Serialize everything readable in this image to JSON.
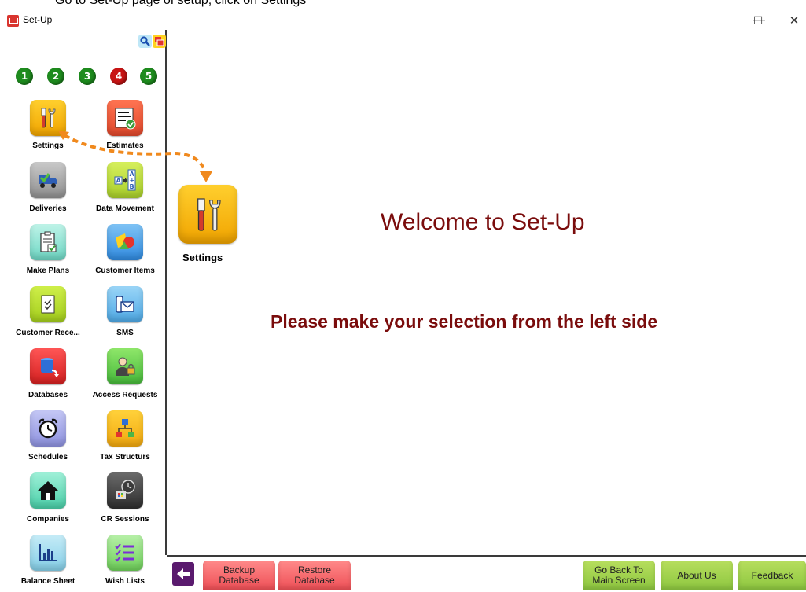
{
  "caption": "Go to Set-Up page of setup, click on Settings",
  "window": {
    "title": "Set-Up",
    "minimize": "—",
    "maximize": "☐",
    "close": "✕"
  },
  "steps": [
    "1",
    "2",
    "3",
    "4",
    "5"
  ],
  "tiles": [
    {
      "label": "Settings"
    },
    {
      "label": "Estimates"
    },
    {
      "label": "Deliveries"
    },
    {
      "label": "Data Movement"
    },
    {
      "label": "Make Plans"
    },
    {
      "label": "Customer Items"
    },
    {
      "label": "Customer Rece..."
    },
    {
      "label": "SMS"
    },
    {
      "label": "Databases"
    },
    {
      "label": "Access Requests"
    },
    {
      "label": "Schedules"
    },
    {
      "label": "Tax Structurs"
    },
    {
      "label": "Companies"
    },
    {
      "label": "CR Sessions"
    },
    {
      "label": "Balance Sheet"
    },
    {
      "label": "Wish Lists"
    }
  ],
  "main": {
    "welcome": "Welcome to Set-Up",
    "instruction": "Please make your selection from the left side",
    "selected_label": "Settings"
  },
  "bottom": {
    "backup_line1": "Backup",
    "backup_line2": "Database",
    "restore_line1": "Restore",
    "restore_line2": "Database",
    "goback_line1": "Go Back To",
    "goback_line2": "Main Screen",
    "about": "About Us",
    "feedback": "Feedback"
  },
  "colors": {
    "accent_text": "#7a0c0c",
    "step_green": "#1e8c1e",
    "step_red": "#c81414"
  }
}
